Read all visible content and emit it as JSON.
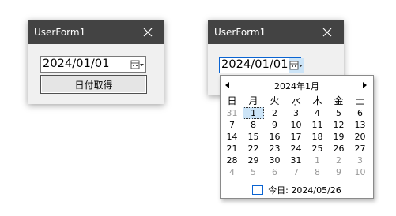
{
  "window1": {
    "title": "UserForm1",
    "date_value": "2024/01/01",
    "button_label": "日付取得"
  },
  "window2": {
    "title": "UserForm1",
    "date_value": "2024/01/01"
  },
  "calendar": {
    "month_title": "2024年1月",
    "weekdays": [
      "日",
      "月",
      "火",
      "水",
      "木",
      "金",
      "土"
    ],
    "weeks": [
      [
        "31",
        "1",
        "2",
        "3",
        "4",
        "5",
        "6"
      ],
      [
        "7",
        "8",
        "9",
        "10",
        "11",
        "12",
        "13"
      ],
      [
        "14",
        "15",
        "16",
        "17",
        "18",
        "19",
        "20"
      ],
      [
        "21",
        "22",
        "23",
        "24",
        "25",
        "26",
        "27"
      ],
      [
        "28",
        "29",
        "30",
        "31",
        "1",
        "2",
        "3"
      ],
      [
        "4",
        "5",
        "6",
        "7",
        "8",
        "9",
        "10"
      ]
    ],
    "selected_day": "1",
    "today_label": "今日: 2024/05/26"
  },
  "colors": {
    "titlebar": "#434343",
    "selection": "#cce4f7",
    "focus_border": "#0a64d2"
  }
}
